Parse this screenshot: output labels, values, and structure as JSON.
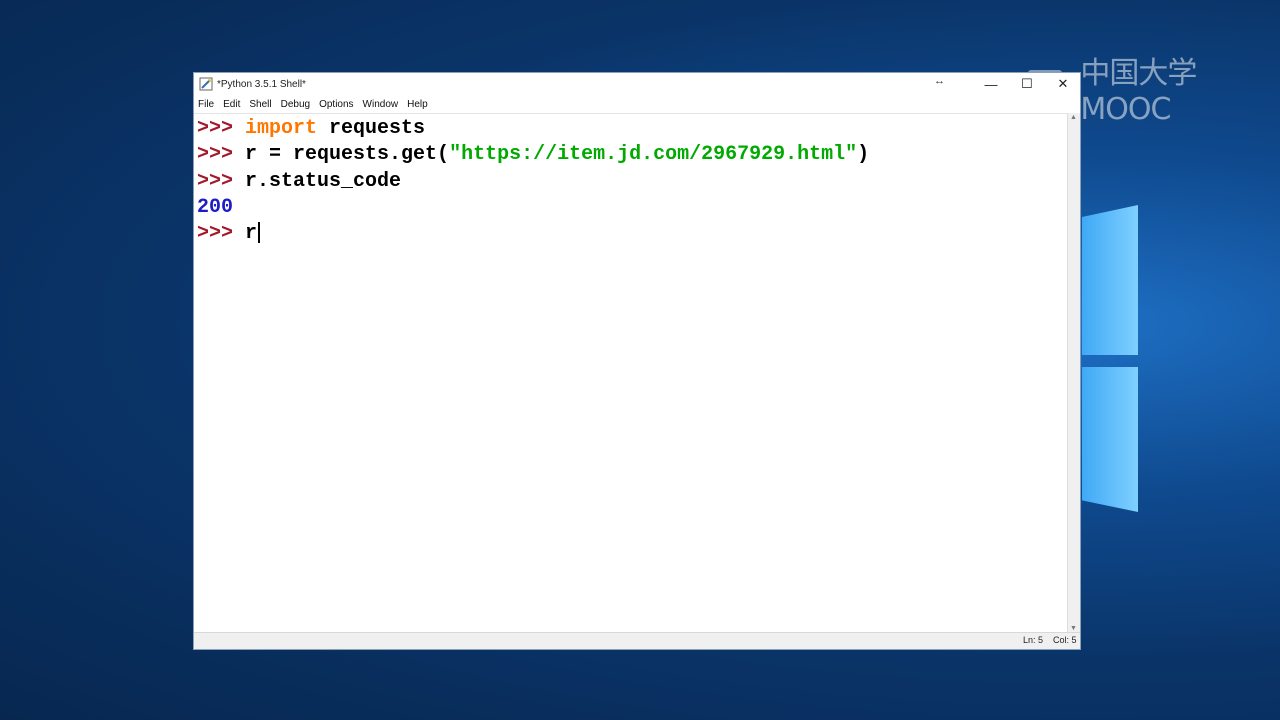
{
  "desktop": {
    "watermark_text": "中国大学MOOC",
    "accent": "#3fa9f5"
  },
  "window": {
    "title": "*Python 3.5.1 Shell*",
    "controls": {
      "minimize": "—",
      "maximize": "☐",
      "close": "✕",
      "resize": "↔"
    }
  },
  "menu": [
    "File",
    "Edit",
    "Shell",
    "Debug",
    "Options",
    "Window",
    "Help"
  ],
  "shell": {
    "lines": [
      {
        "prompt": ">>> ",
        "parts": [
          {
            "text": "import",
            "kind": "kw"
          },
          {
            "text": " requests",
            "kind": "plain"
          }
        ]
      },
      {
        "prompt": ">>> ",
        "parts": [
          {
            "text": "r = requests.get(",
            "kind": "plain"
          },
          {
            "text": "\"https://item.jd.com/2967929.html\"",
            "kind": "str"
          },
          {
            "text": ")",
            "kind": "plain"
          }
        ]
      },
      {
        "prompt": ">>> ",
        "parts": [
          {
            "text": "r.status_code",
            "kind": "plain"
          }
        ]
      },
      {
        "prompt": "",
        "parts": [
          {
            "text": "200",
            "kind": "out"
          }
        ]
      },
      {
        "prompt": ">>> ",
        "parts": [
          {
            "text": "r",
            "kind": "plain"
          }
        ]
      }
    ],
    "colors": {
      "prompt": "#a3192b",
      "keyword": "#ff7700",
      "string": "#00aa00",
      "output": "#1c1cc8"
    }
  },
  "status": {
    "line": "Ln: 5",
    "col": "Col: 5"
  }
}
